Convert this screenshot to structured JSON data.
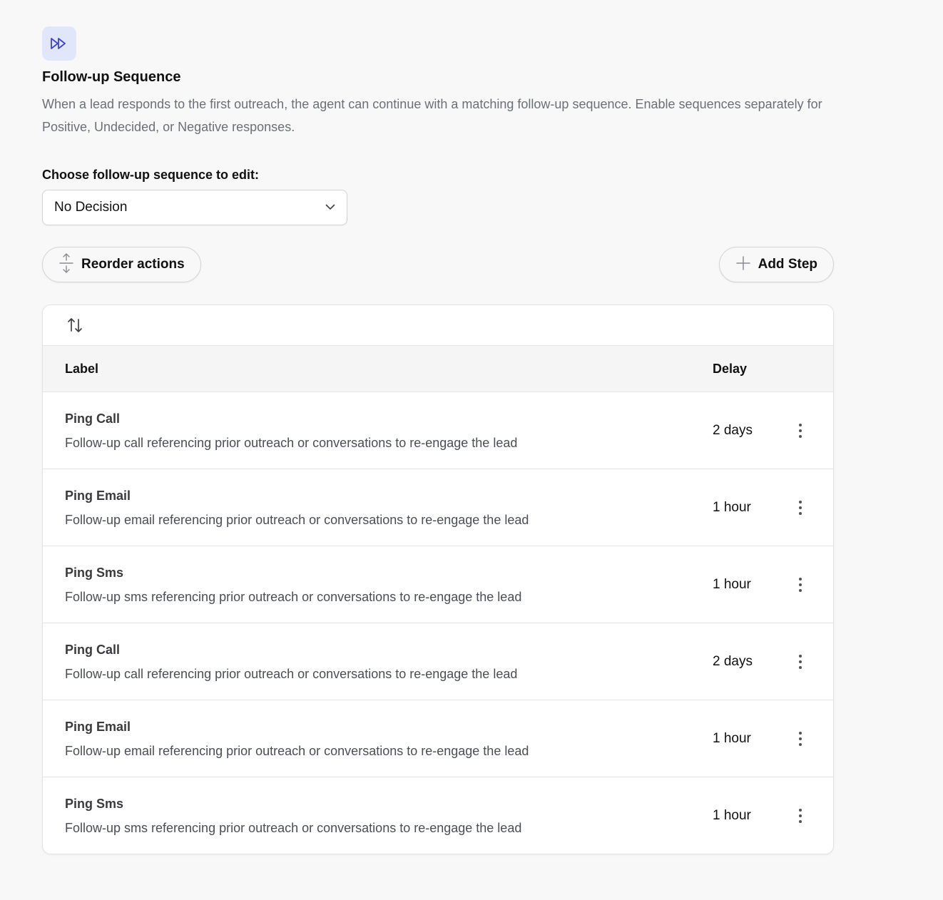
{
  "section": {
    "icon": "fast-forward-icon",
    "title": "Follow-up Sequence",
    "description": "When a lead responds to the first outreach, the agent can continue with a matching follow-up sequence. Enable sequences separately for Positive, Undecided, or Negative responses."
  },
  "sequence_select": {
    "label": "Choose follow-up sequence to edit:",
    "value": "No Decision",
    "icon": "chevron-down-icon"
  },
  "toolbar": {
    "reorder_label": "Reorder actions",
    "reorder_icon": "reorder-vertical-icon",
    "add_label": "Add Step",
    "add_icon": "plus-icon"
  },
  "table": {
    "sort_icon": "sort-arrows-icon",
    "columns": [
      "Label",
      "Delay"
    ],
    "rows": [
      {
        "title": "Ping Call",
        "description": "Follow-up call referencing prior outreach or conversations to re-engage the lead",
        "delay": "2 days"
      },
      {
        "title": "Ping Email",
        "description": "Follow-up email referencing prior outreach or conversations to re-engage the lead",
        "delay": "1 hour"
      },
      {
        "title": "Ping Sms",
        "description": "Follow-up sms referencing prior outreach or conversations to re-engage the lead",
        "delay": "1 hour"
      },
      {
        "title": "Ping Call",
        "description": "Follow-up call referencing prior outreach or conversations to re-engage the lead",
        "delay": "2 days"
      },
      {
        "title": "Ping Email",
        "description": "Follow-up email referencing prior outreach or conversations to re-engage the lead",
        "delay": "1 hour"
      },
      {
        "title": "Ping Sms",
        "description": "Follow-up sms referencing prior outreach or conversations to re-engage the lead",
        "delay": "1 hour"
      }
    ]
  },
  "colors": {
    "accent": "#3b43d6",
    "icon_bg": "#e2e6fb",
    "muted_text": "#6b6f78"
  }
}
